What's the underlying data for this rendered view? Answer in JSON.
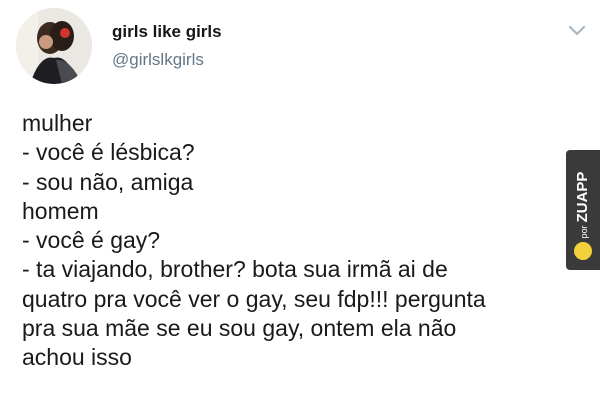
{
  "profile": {
    "display_name": "girls like girls",
    "handle": "@girlslkgirls"
  },
  "tweet": {
    "lines": [
      "mulher",
      "- você é lésbica?",
      "- sou não, amiga",
      "homem",
      "- você é gay?",
      "- ta viajando, brother? bota sua irmã ai de",
      "quatro pra você ver o gay, seu fdp!!! pergunta",
      "pra sua mãe se eu sou gay, ontem ela não",
      "achou isso"
    ]
  },
  "watermark": {
    "prefix": "por",
    "brand": "ZUAPP"
  },
  "icons": {
    "menu": "chevron-down-icon",
    "watermark_logo": "zuapp-logo-icon"
  }
}
